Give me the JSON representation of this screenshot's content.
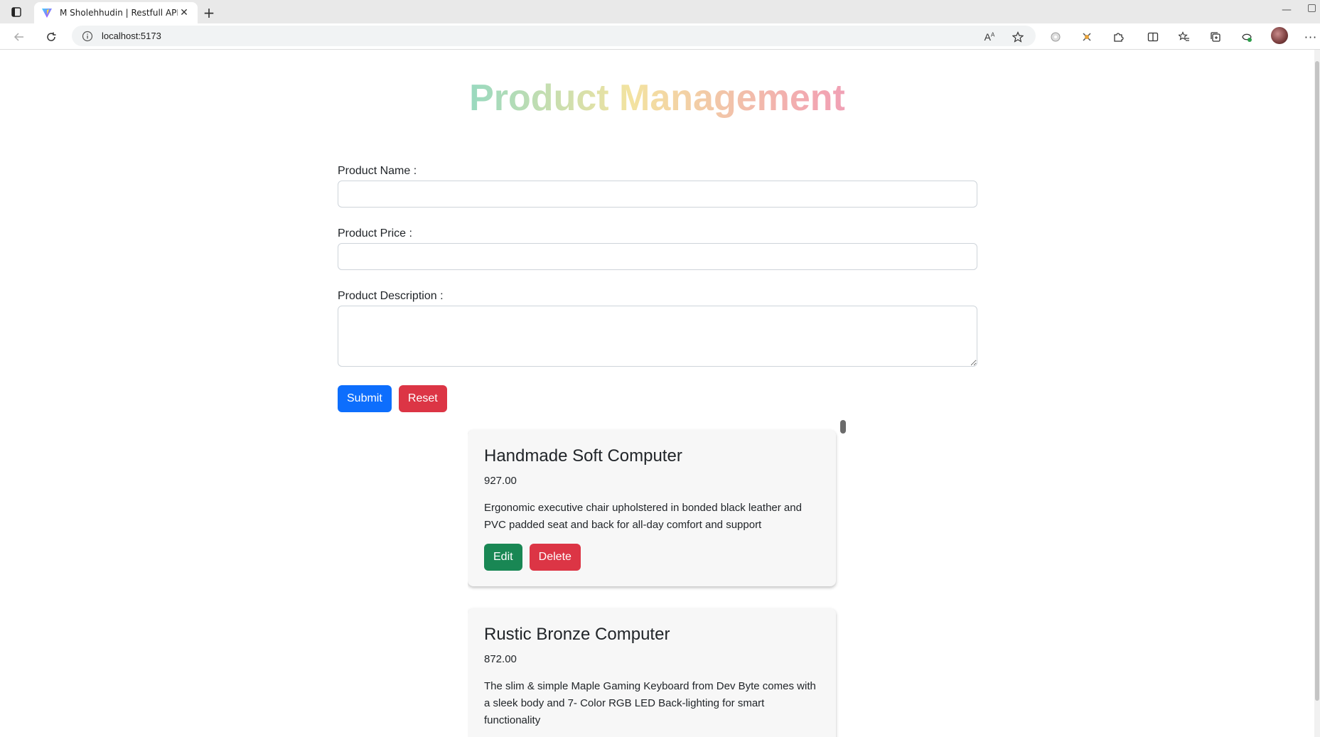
{
  "browser": {
    "tab_title": "M Sholehhudin | Restfull API",
    "new_tab_label": "+",
    "url": "localhost:5173"
  },
  "page": {
    "title": "Product Management",
    "form": {
      "name_label": "Product Name :",
      "name_value": "",
      "price_label": "Product Price :",
      "price_value": "",
      "description_label": "Product Description :",
      "description_value": "",
      "submit_label": "Submit",
      "reset_label": "Reset"
    },
    "products": [
      {
        "name": "Handmade Soft Computer",
        "price": "927.00",
        "description": "Ergonomic executive chair upholstered in bonded black leather and PVC padded seat and back for all-day comfort and support",
        "edit_label": "Edit",
        "delete_label": "Delete"
      },
      {
        "name": "Rustic Bronze Computer",
        "price": "872.00",
        "description": "The slim & simple Maple Gaming Keyboard from Dev Byte comes with a sleek body and 7- Color RGB LED Back-lighting for smart functionality"
      }
    ]
  },
  "colors": {
    "primary": "#0d6efd",
    "danger": "#dc3545",
    "success": "#198754",
    "title_gradient": [
      "#2ec5e6",
      "#7ed6c9",
      "#f3e3a0",
      "#f2a7b1",
      "#e77fd0",
      "#c548d6"
    ]
  },
  "icons": {
    "tab_actions": "tab-actions-icon",
    "favicon": "vite-logo-icon",
    "close": "close-icon",
    "back": "back-arrow-icon",
    "reload": "reload-icon",
    "info": "info-icon",
    "read_aloud": "read-aloud-icon",
    "favorite": "star-icon",
    "extensions": "puzzle-icon",
    "split": "split-screen-icon",
    "favorites": "favorites-icon",
    "collections": "collections-icon",
    "more": "more-icon"
  }
}
